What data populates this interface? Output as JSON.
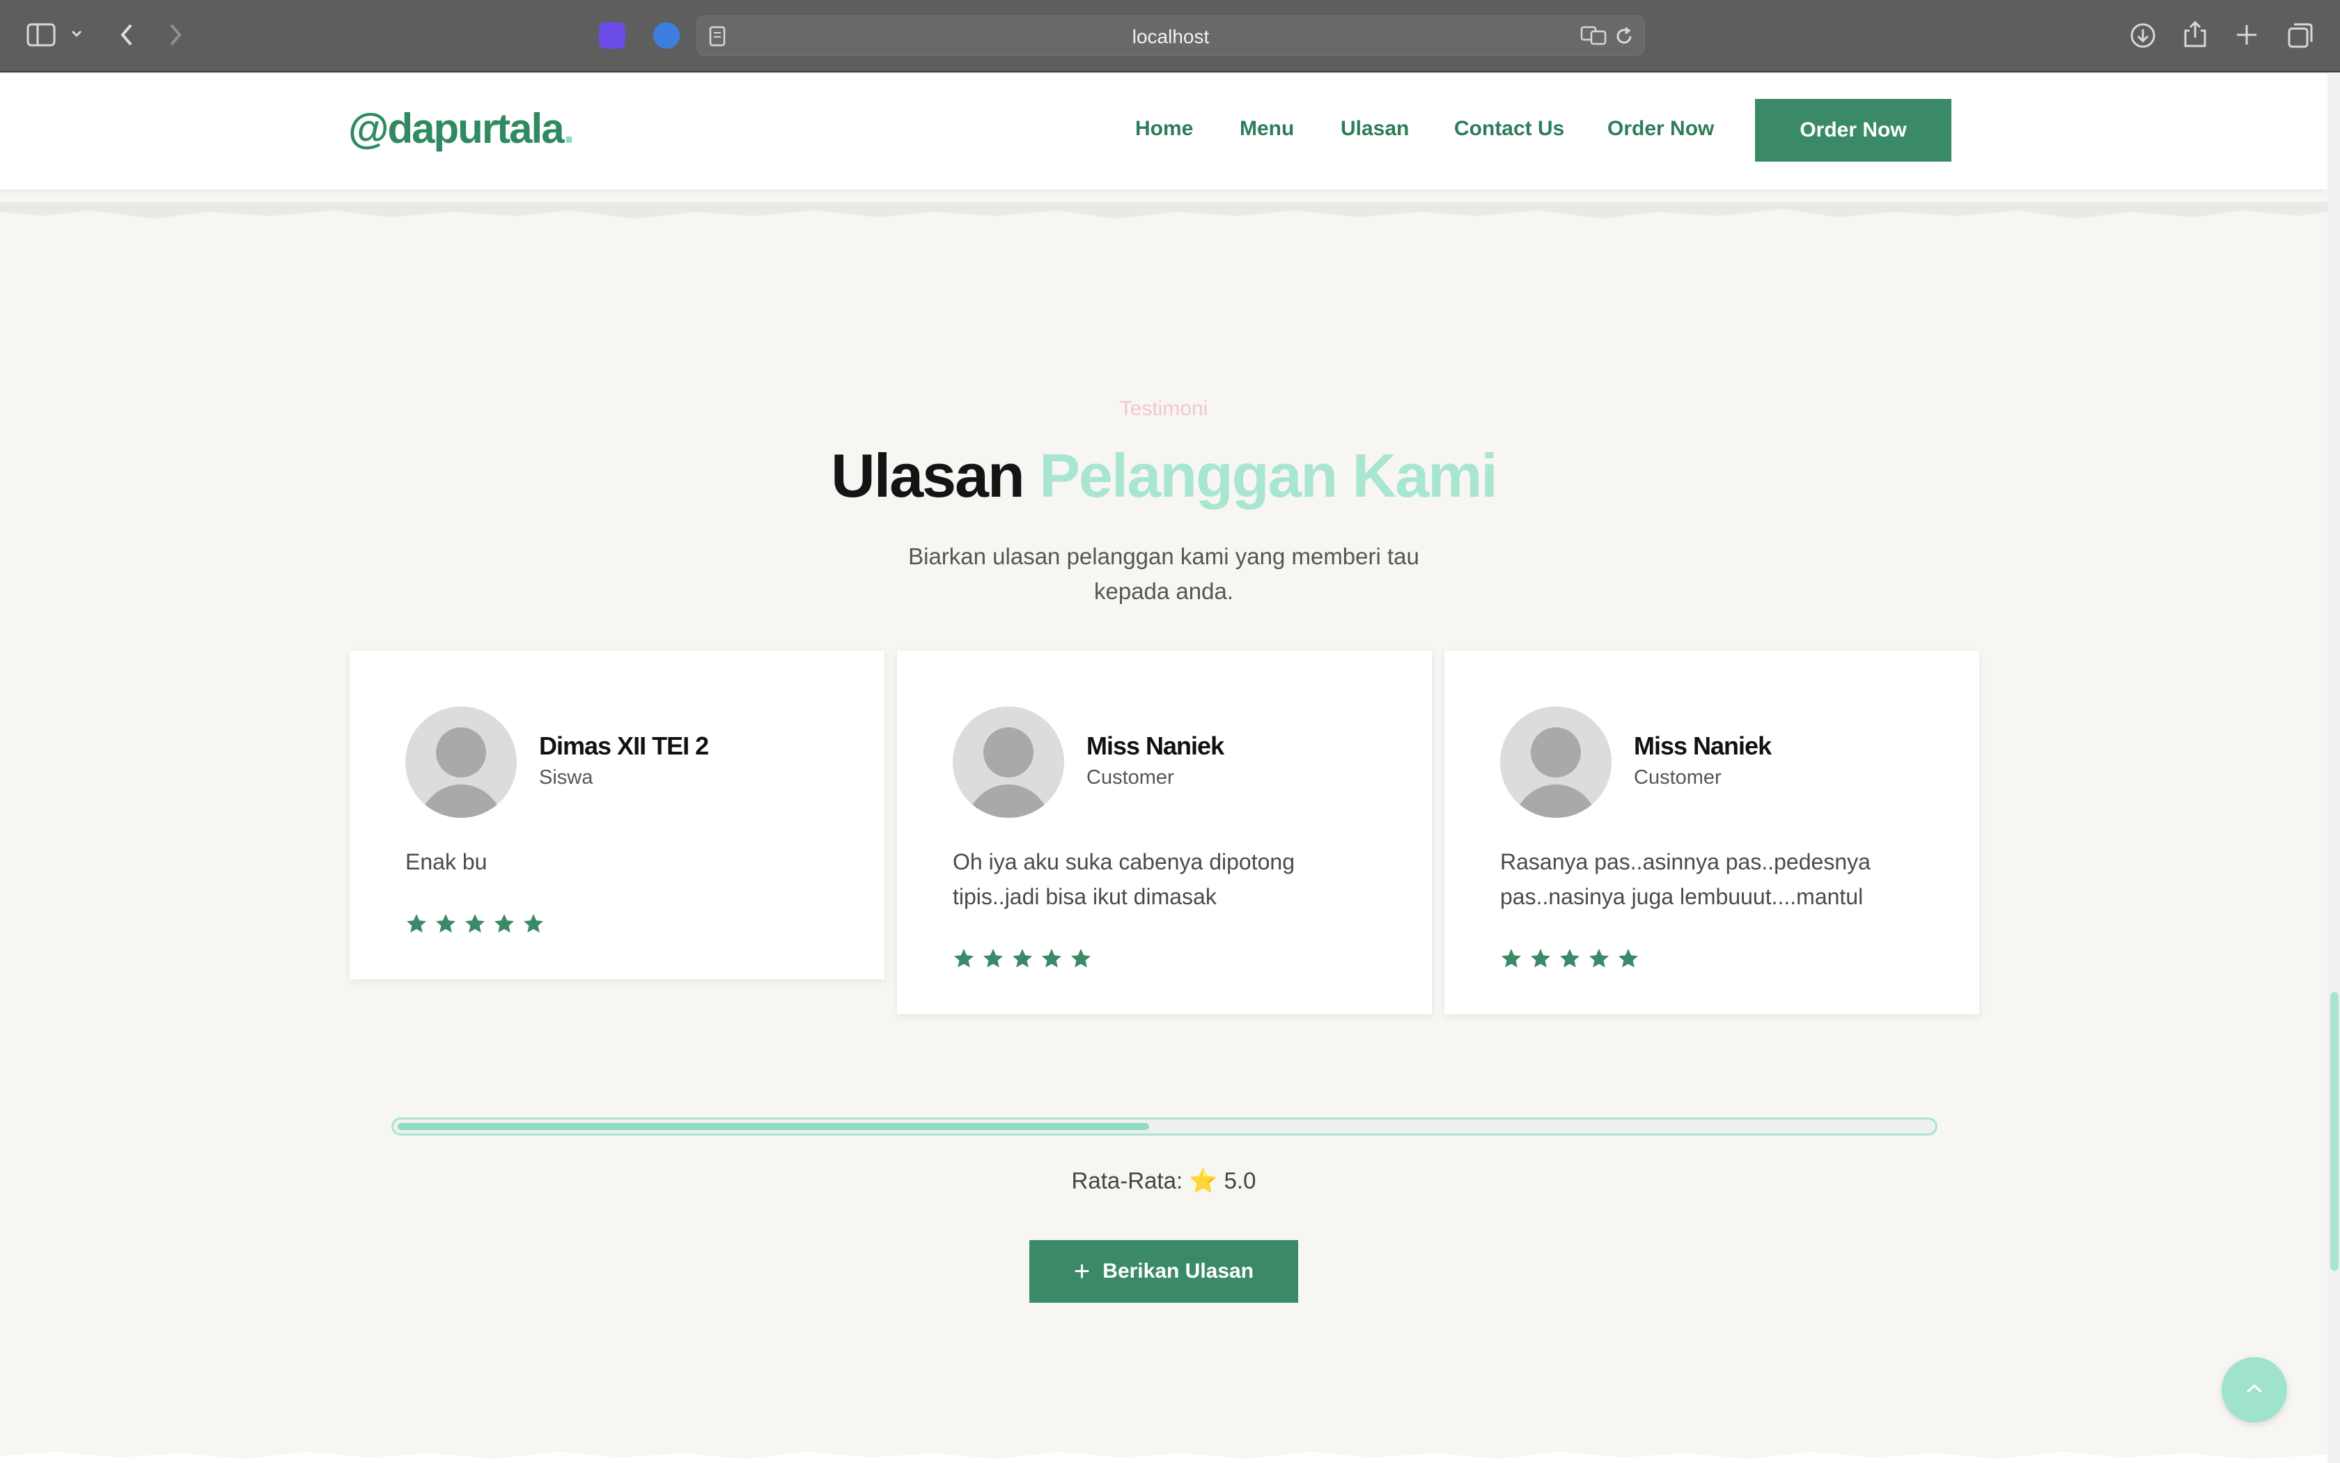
{
  "browser": {
    "url": "localhost",
    "icons": [
      "sidebar-icon",
      "chevron-down-icon",
      "back-icon",
      "forward-icon",
      "reader-icon",
      "translate-icon",
      "reload-icon",
      "download-icon",
      "share-icon",
      "new-tab-icon",
      "tabs-overview-icon"
    ]
  },
  "nav": {
    "logo": "@dapurtala",
    "logo_dot": ".",
    "links": [
      "Home",
      "Menu",
      "Ulasan",
      "Contact Us",
      "Order Now"
    ],
    "cta": "Order Now"
  },
  "section": {
    "eyebrow": "Testimoni",
    "heading_dark": "Ulasan",
    "heading_accent": "Pelanggan Kami",
    "subtitle": "Biarkan ulasan pelanggan kami yang memberi tau kepada anda."
  },
  "reviews": [
    {
      "name": "Dimas XII TEI 2",
      "role": "Siswa",
      "text": "Enak bu",
      "rating": 5
    },
    {
      "name": "Miss Naniek",
      "role": "Customer",
      "text": "Oh iya aku suka cabenya dipotong tipis..jadi bisa ikut dimasak",
      "rating": 5
    },
    {
      "name": "Miss Naniek",
      "role": "Customer",
      "text": "Rasanya pas..asinnya pas..pedesnya pas..nasinya juga lembuuut....mantul",
      "rating": 5
    }
  ],
  "carousel": {
    "progress_fraction": 0.49
  },
  "average": {
    "label": "Rata-Rata:",
    "icon": "⭐",
    "value": "5.0"
  },
  "review_button": {
    "icon": "+",
    "label": "Berikan Ulasan"
  },
  "colors": {
    "primary": "#3b8a67",
    "accent": "#a8e6d2",
    "eyebrow": "#f1c9cf",
    "star": "#3b8a67"
  }
}
